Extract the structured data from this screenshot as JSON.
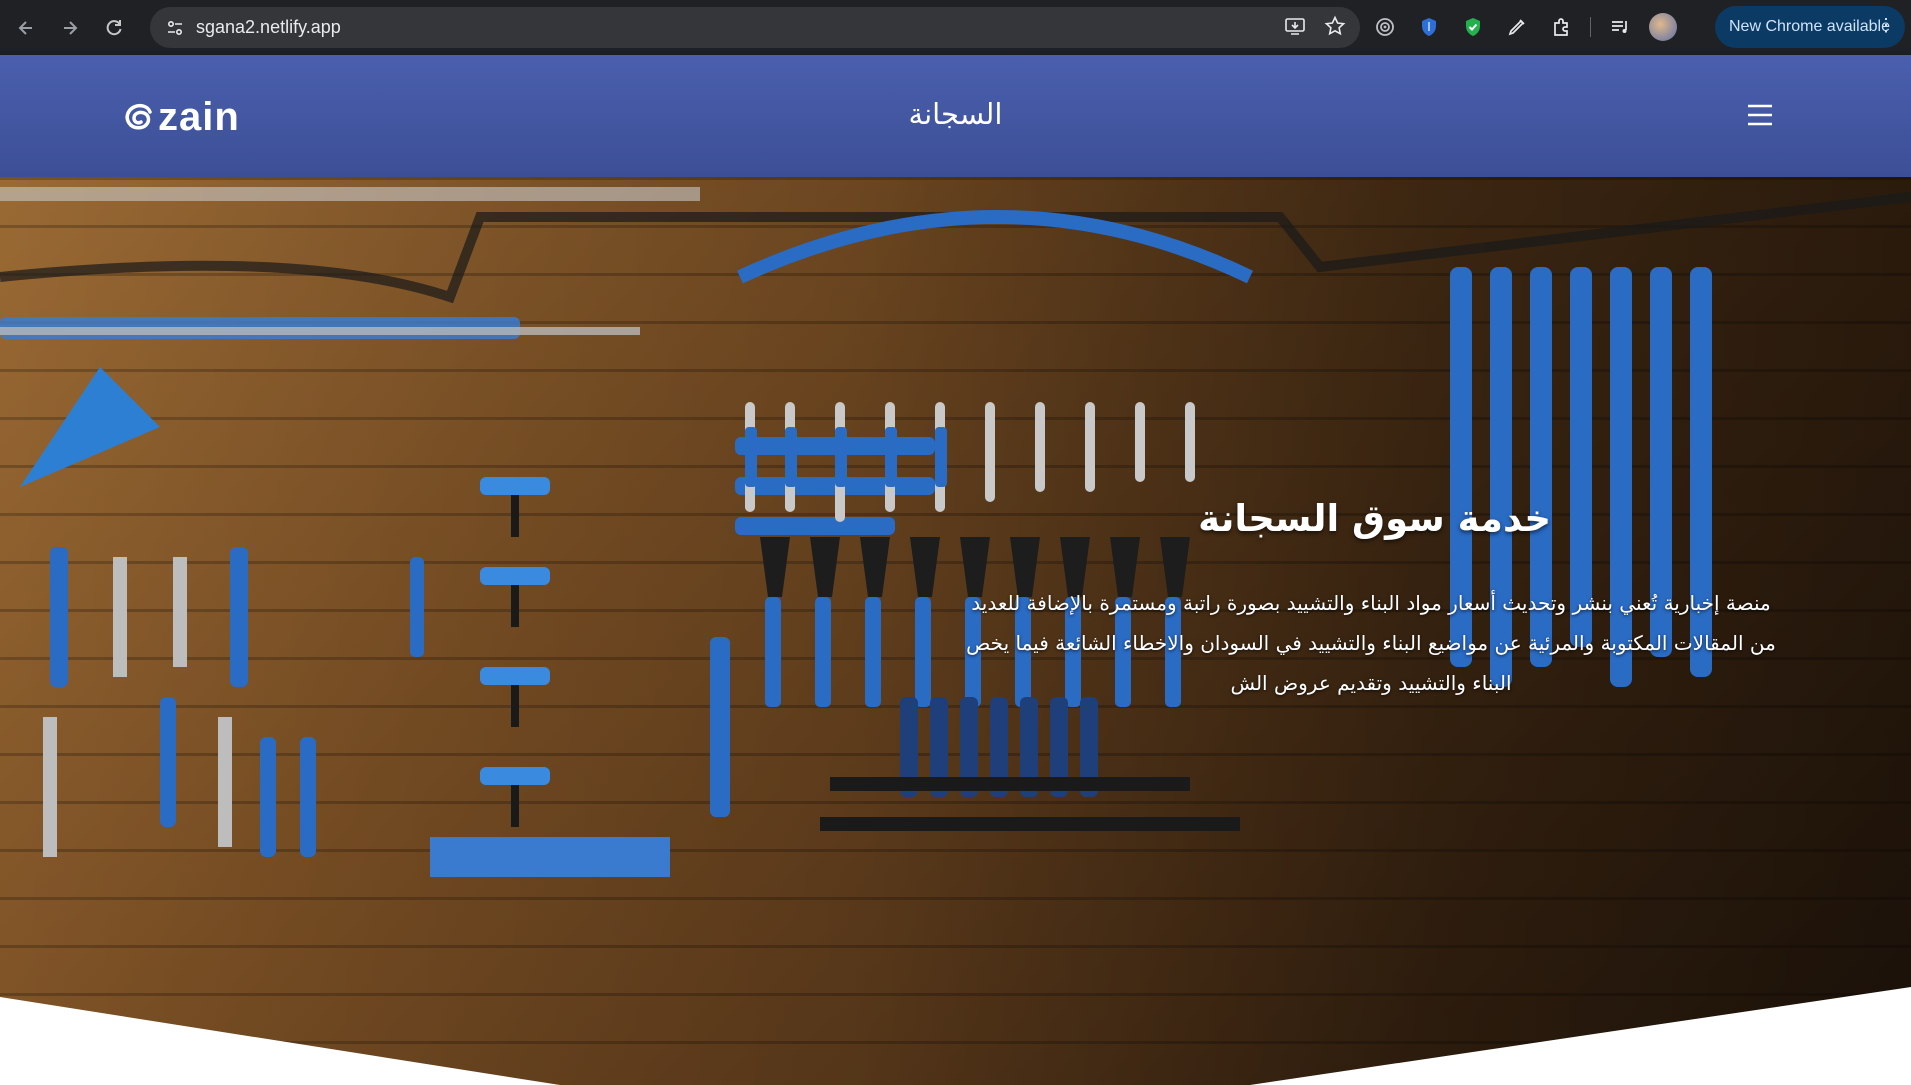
{
  "browser": {
    "url": "sgana2.netlify.app",
    "update_label": "New Chrome available",
    "icons": [
      "back-icon",
      "forward-icon",
      "reload-icon",
      "site-settings-icon",
      "install-app-icon",
      "bookmark-star-icon",
      "extension-target-icon",
      "extension-shield-icon",
      "extension-green-shield-icon",
      "extension-pen-icon",
      "extensions-puzzle-icon",
      "media-controls-icon",
      "profile-avatar",
      "more-menu-icon"
    ]
  },
  "header": {
    "logo_text": "zain",
    "title": "السجانة",
    "menu_icon": "hamburger-menu-icon"
  },
  "hero": {
    "title": "خدمة سوق السجانة",
    "description": "منصة إخبارية تُعني بنشر وتحديث أسعار مواد البناء والتشييد بصورة راتبة ومستمرة بالإضافة للعديد من المقالات المكتوبة والمرئية عن مواضيع البناء والتشييد في السودان والاخطاء الشائعة فيما يخص البناء والتشييد وتقديم عروض الش",
    "background": "tool-wall-photo"
  },
  "colors": {
    "header_bg": "#4a5fae",
    "chrome_bg": "#202124",
    "tool_blue": "#2a6bc4"
  }
}
